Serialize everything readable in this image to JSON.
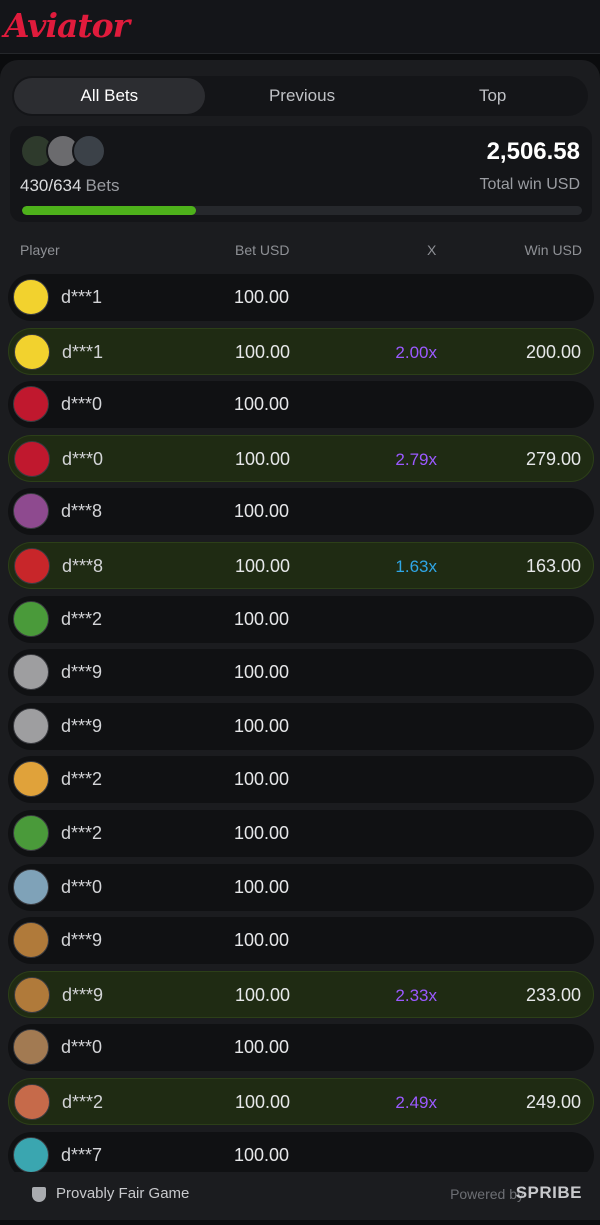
{
  "app": {
    "logo": "Aviator"
  },
  "tabs": [
    {
      "label": "All Bets",
      "active": true
    },
    {
      "label": "Previous",
      "active": false
    },
    {
      "label": "Top",
      "active": false
    }
  ],
  "summary": {
    "bets_count": "430/634",
    "bets_label": "Bets",
    "total_win": "2,506.58",
    "total_win_label": "Total win USD",
    "progress_fraction": 0.31
  },
  "columns": {
    "player": "Player",
    "bet": "Bet USD",
    "x": "X",
    "win": "Win USD"
  },
  "rows": [
    {
      "player": "d***1",
      "bet": "100.00",
      "x": "",
      "win": "",
      "won": false,
      "avatar_color": "#f2d22e"
    },
    {
      "player": "d***1",
      "bet": "100.00",
      "x": "2.00x",
      "win": "200.00",
      "won": true,
      "avatar_color": "#f2d22e",
      "x_color": "#9b59ff"
    },
    {
      "player": "d***0",
      "bet": "100.00",
      "x": "",
      "win": "",
      "won": false,
      "avatar_color": "#c0182e"
    },
    {
      "player": "d***0",
      "bet": "100.00",
      "x": "2.79x",
      "win": "279.00",
      "won": true,
      "avatar_color": "#c0182e",
      "x_color": "#9b59ff"
    },
    {
      "player": "d***8",
      "bet": "100.00",
      "x": "",
      "win": "",
      "won": false,
      "avatar_color": "#8e4a8f"
    },
    {
      "player": "d***8",
      "bet": "100.00",
      "x": "1.63x",
      "win": "163.00",
      "won": true,
      "avatar_color": "#c8262a",
      "x_color": "#2fa6e6"
    },
    {
      "player": "d***2",
      "bet": "100.00",
      "x": "",
      "win": "",
      "won": false,
      "avatar_color": "#4a9a3a"
    },
    {
      "player": "d***9",
      "bet": "100.00",
      "x": "",
      "win": "",
      "won": false,
      "avatar_color": "#9e9ea0"
    },
    {
      "player": "d***9",
      "bet": "100.00",
      "x": "",
      "win": "",
      "won": false,
      "avatar_color": "#9e9ea0"
    },
    {
      "player": "d***2",
      "bet": "100.00",
      "x": "",
      "win": "",
      "won": false,
      "avatar_color": "#e0a23a"
    },
    {
      "player": "d***2",
      "bet": "100.00",
      "x": "",
      "win": "",
      "won": false,
      "avatar_color": "#4a9a3a"
    },
    {
      "player": "d***0",
      "bet": "100.00",
      "x": "",
      "win": "",
      "won": false,
      "avatar_color": "#7fa2b8"
    },
    {
      "player": "d***9",
      "bet": "100.00",
      "x": "",
      "win": "",
      "won": false,
      "avatar_color": "#b07a3a"
    },
    {
      "player": "d***9",
      "bet": "100.00",
      "x": "2.33x",
      "win": "233.00",
      "won": true,
      "avatar_color": "#b07a3a",
      "x_color": "#9b59ff"
    },
    {
      "player": "d***0",
      "bet": "100.00",
      "x": "",
      "win": "",
      "won": false,
      "avatar_color": "#a27a52"
    },
    {
      "player": "d***2",
      "bet": "100.00",
      "x": "2.49x",
      "win": "249.00",
      "won": true,
      "avatar_color": "#c66a4a",
      "x_color": "#9b59ff"
    },
    {
      "player": "d***7",
      "bet": "100.00",
      "x": "",
      "win": "",
      "won": false,
      "avatar_color": "#3aa6b0"
    }
  ],
  "footer": {
    "fair_label": "Provably Fair Game",
    "powered_label": "Powered by",
    "brand": "SPRIBE"
  },
  "icons": {
    "shield": "shield-icon"
  }
}
